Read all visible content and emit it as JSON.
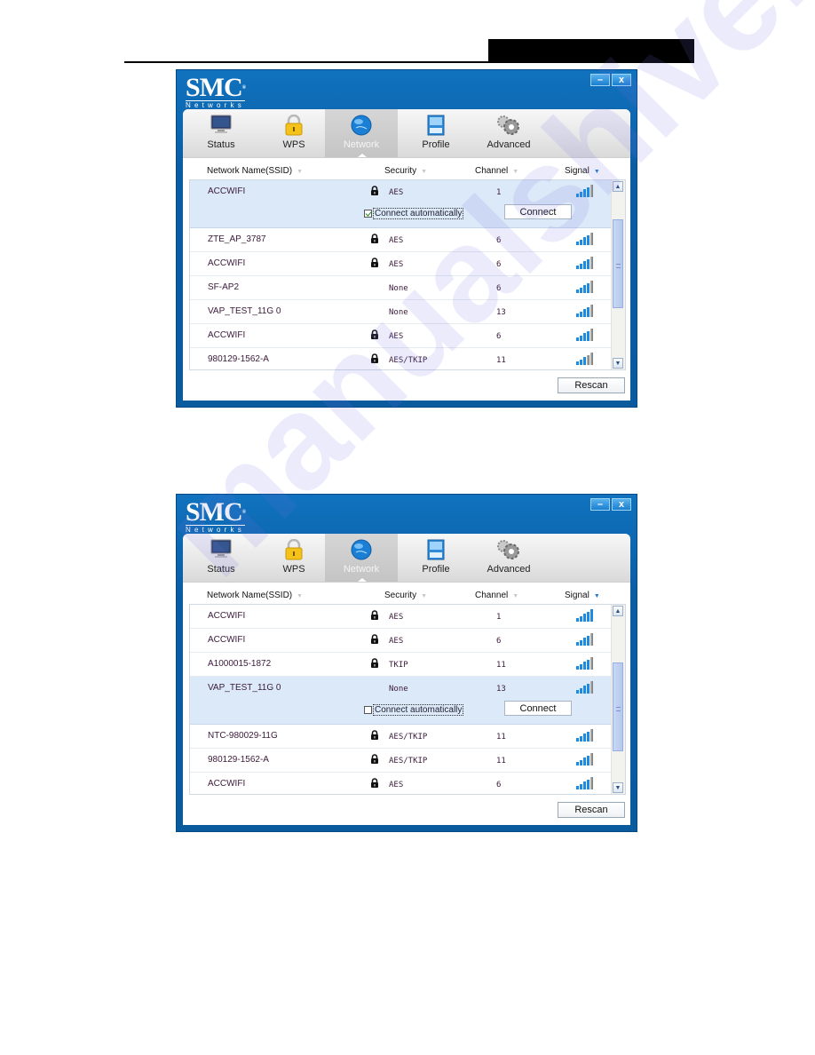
{
  "page": {
    "watermark": "manualshive.com"
  },
  "app": {
    "logo_main": "SMC",
    "logo_registered": "®",
    "logo_sub": "Networks",
    "minimize_label": "–",
    "close_label": "x"
  },
  "tabs": [
    {
      "label": "Status",
      "icon": "monitor-icon"
    },
    {
      "label": "WPS",
      "icon": "padlock-icon"
    },
    {
      "label": "Network",
      "icon": "globe-icon",
      "active": true
    },
    {
      "label": "Profile",
      "icon": "profile-card-icon"
    },
    {
      "label": "Advanced",
      "icon": "gears-icon"
    }
  ],
  "columns": {
    "name": "Network Name(SSID)",
    "security": "Security",
    "channel": "Channel",
    "signal": "Signal",
    "sorted_by": "Signal"
  },
  "colors": {
    "window_blue": "#0b5da3",
    "selected_row": "#dce9f8",
    "signal_bar": "#1e8be0"
  },
  "windows": [
    {
      "networks": [
        {
          "ssid": "ACCWIFI",
          "locked": true,
          "security": "AES",
          "channel": "1",
          "signal_bars": 4,
          "selected": true,
          "connect_automatically": true
        },
        {
          "ssid": "ZTE_AP_3787",
          "locked": true,
          "security": "AES",
          "channel": "6",
          "signal_bars": 4
        },
        {
          "ssid": "ACCWIFI",
          "locked": true,
          "security": "AES",
          "channel": "6",
          "signal_bars": 4
        },
        {
          "ssid": "SF-AP2",
          "locked": false,
          "security": "None",
          "channel": "6",
          "signal_bars": 4
        },
        {
          "ssid": "VAP_TEST_11G 0",
          "locked": false,
          "security": "None",
          "channel": "13",
          "signal_bars": 4
        },
        {
          "ssid": "ACCWIFI",
          "locked": true,
          "security": "AES",
          "channel": "6",
          "signal_bars": 4
        },
        {
          "ssid": "980129-1562-A",
          "locked": true,
          "security": "AES/TKIP",
          "channel": "11",
          "signal_bars": 3
        }
      ],
      "connect_automatically_label": "Connect automatically",
      "connect_label": "Connect",
      "rescan_label": "Rescan",
      "scroll_position": 0.35
    },
    {
      "networks": [
        {
          "ssid": "ACCWIFI",
          "locked": true,
          "security": "AES",
          "channel": "1",
          "signal_bars": 5
        },
        {
          "ssid": "ACCWIFI",
          "locked": true,
          "security": "AES",
          "channel": "6",
          "signal_bars": 4
        },
        {
          "ssid": "A1000015-1872",
          "locked": true,
          "security": "TKIP",
          "channel": "11",
          "signal_bars": 4
        },
        {
          "ssid": "VAP_TEST_11G 0",
          "locked": false,
          "security": "None",
          "channel": "13",
          "signal_bars": 4,
          "selected": true,
          "connect_automatically": false
        },
        {
          "ssid": "NTC-980029-11G",
          "locked": true,
          "security": "AES/TKIP",
          "channel": "11",
          "signal_bars": 4
        },
        {
          "ssid": "980129-1562-A",
          "locked": true,
          "security": "AES/TKIP",
          "channel": "11",
          "signal_bars": 4
        },
        {
          "ssid": "ACCWIFI",
          "locked": true,
          "security": "AES",
          "channel": "6",
          "signal_bars": 4
        }
      ],
      "connect_automatically_label": "Connect automatically",
      "connect_label": "Connect",
      "rescan_label": "Rescan",
      "scroll_position": 0.6
    }
  ]
}
